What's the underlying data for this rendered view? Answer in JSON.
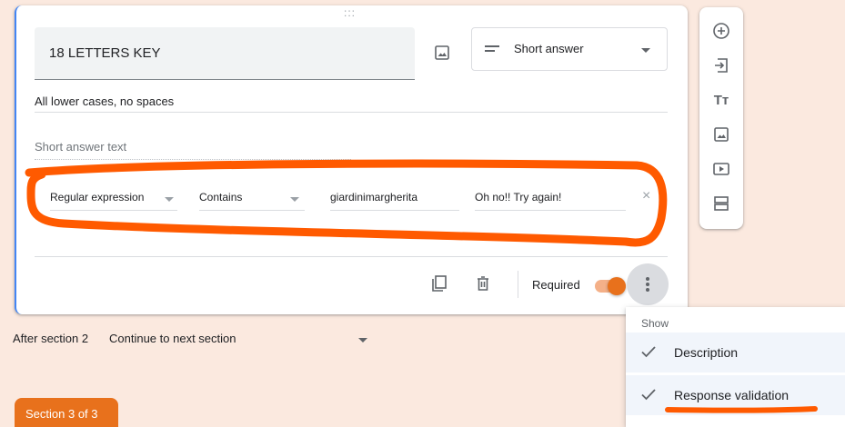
{
  "question": {
    "drag_handle": ":::",
    "title": "18 LETTERS KEY",
    "type": "Short answer",
    "description": "All lower cases, no spaces",
    "answer_placeholder": "Short answer text"
  },
  "validation": {
    "kind": "Regular expression",
    "condition": "Contains",
    "pattern": "giardinimargherita",
    "error_text": "Oh no!! Try again!",
    "close_glyph": "×"
  },
  "footer": {
    "required_label": "Required",
    "required": true
  },
  "side_toolbar": {
    "text_tool_label": "Tт"
  },
  "section": {
    "after_label": "After section 2",
    "after_value": "Continue to next section",
    "tab_label": "Section 3 of 3"
  },
  "menu": {
    "header": "Show",
    "items": [
      {
        "label": "Description",
        "checked": true
      },
      {
        "label": "Response validation",
        "checked": true
      }
    ]
  },
  "colors": {
    "accent": "#e8711c",
    "annotation": "#ff5a00",
    "background": "#fbe9df"
  }
}
